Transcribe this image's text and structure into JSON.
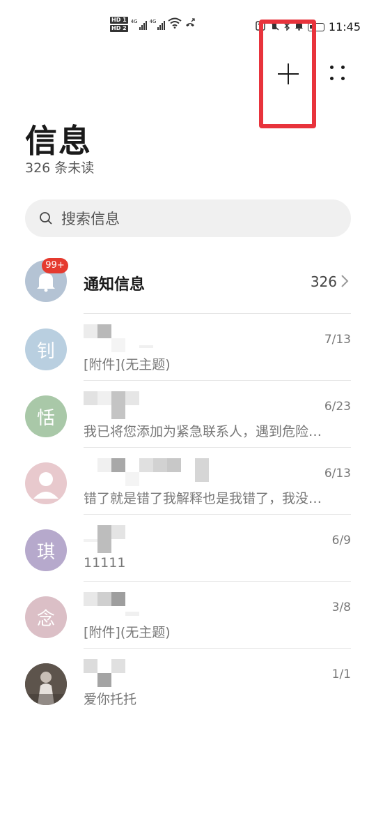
{
  "status_bar": {
    "hd1": "HD 1",
    "hd2": "HD 2",
    "net1": "4G",
    "net2": "4G",
    "time": "11:45"
  },
  "header": {
    "title": "信息",
    "unread": "326 条未读"
  },
  "search": {
    "placeholder": "搜索信息"
  },
  "notification": {
    "title": "通知信息",
    "count": "326",
    "badge": "99+"
  },
  "conversations": [
    {
      "avatar_char": "钊",
      "avatar_color": "#b9cfe0",
      "date": "7/13",
      "preview": "[附件](无主题)"
    },
    {
      "avatar_char": "恬",
      "avatar_color": "#a9c8a8",
      "date": "6/23",
      "preview": "我已将您添加为紧急联系人，遇到危险…"
    },
    {
      "avatar_char": "",
      "avatar_color": "#e8c9cd",
      "date": "6/13",
      "preview": "错了就是错了我解释也是我错了，我没…"
    },
    {
      "avatar_char": "琪",
      "avatar_color": "#b6a9cc",
      "date": "6/9",
      "preview": "11111"
    },
    {
      "avatar_char": "念",
      "avatar_color": "#dbbfc6",
      "date": "3/8",
      "preview": "[附件](无主题)"
    },
    {
      "avatar_char": "",
      "avatar_color": "#6b6058",
      "date": "1/1",
      "preview": "爱你托托"
    }
  ],
  "icons": [
    "add-icon",
    "more-icon",
    "search-icon",
    "bell-icon",
    "chevron-right-icon",
    "person-icon"
  ],
  "colors": {
    "badge": "#e53a2f",
    "highlight": "#e8333c"
  }
}
